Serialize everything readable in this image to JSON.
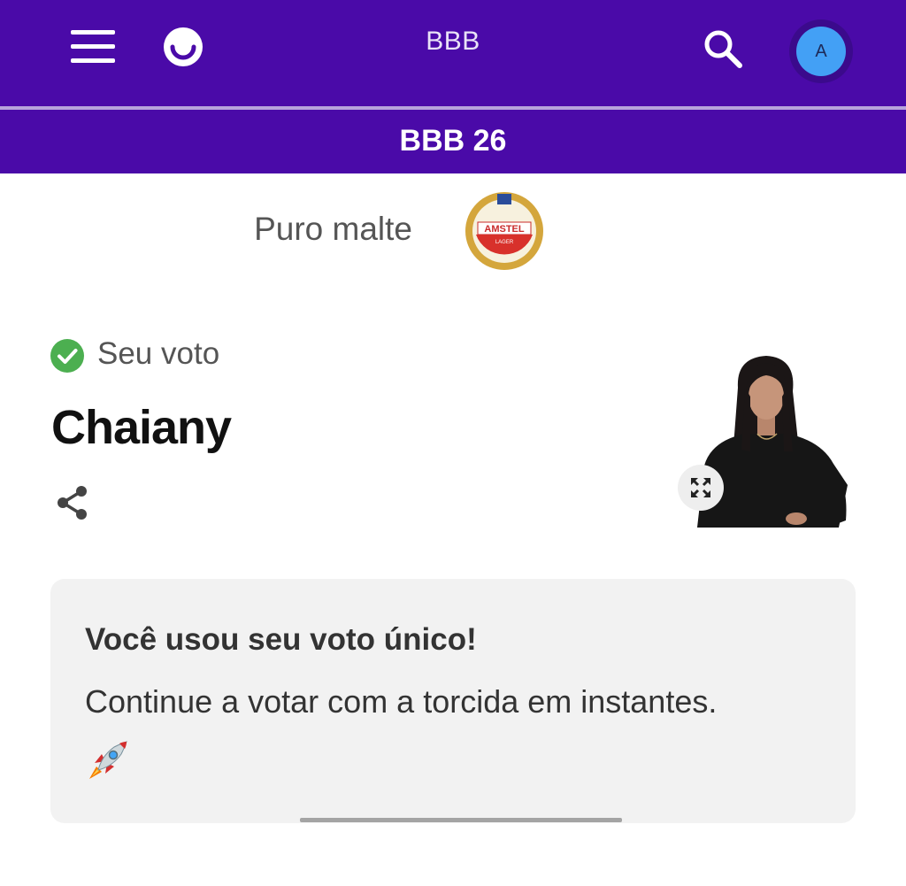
{
  "header": {
    "title": "BBB",
    "menu_icon": "hamburger-menu-icon",
    "logo_icon": "smiley-logo-icon",
    "search_icon": "search-icon",
    "avatar_initial": "A",
    "avatar_color": "#43a0f5",
    "background_color": "#4a0aa8"
  },
  "subheader": {
    "title": "BBB 26"
  },
  "sponsor": {
    "text": "Puro malte",
    "logo_text": "AMSTEL",
    "logo_subtext": "LAGER"
  },
  "vote": {
    "status_text": "Seu voto",
    "status_icon": "check-circle-icon",
    "status_color": "#4caf50",
    "candidate_name": "Chaiany",
    "share_icon": "share-icon",
    "expand_icon": "expand-icon"
  },
  "card": {
    "title": "Você usou seu voto único!",
    "text": "Continue a votar com a torcida em instantes.",
    "icon": "rocket-icon"
  }
}
